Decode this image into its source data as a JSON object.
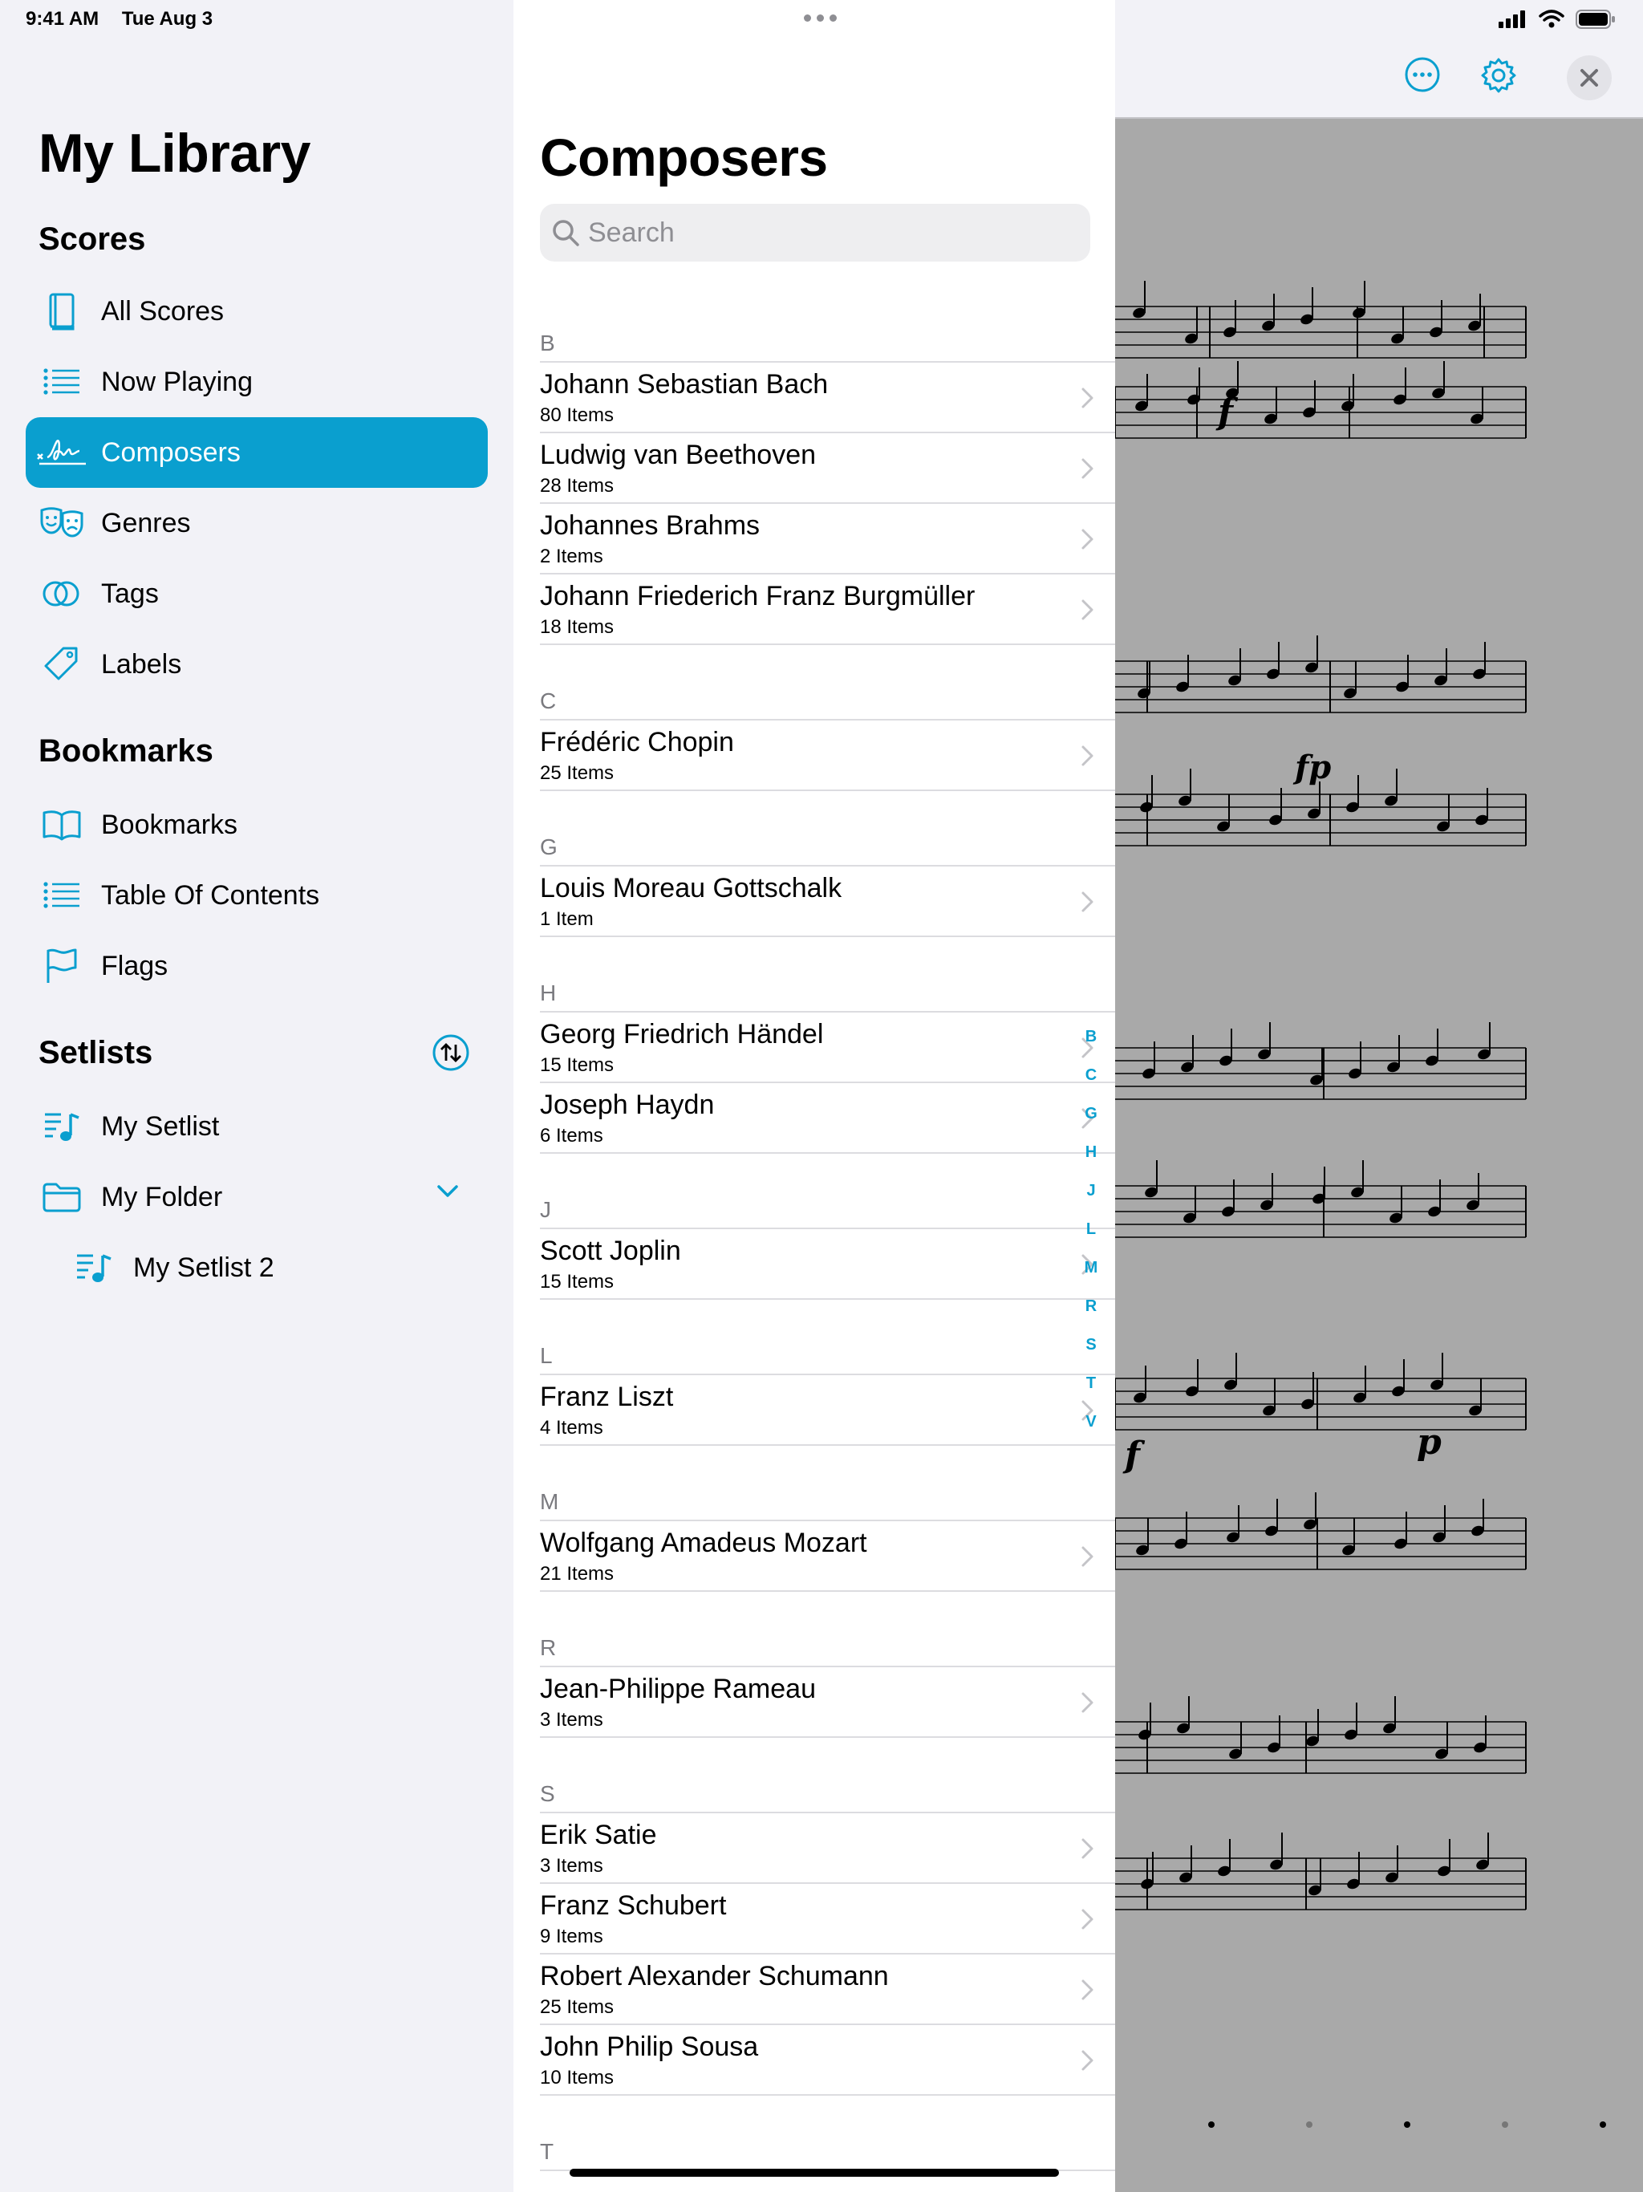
{
  "status_bar": {
    "time": "9:41 AM",
    "date": "Tue Aug 3"
  },
  "sidebar": {
    "title": "My Library",
    "sections": {
      "scores": "Scores",
      "bookmarks": "Bookmarks",
      "setlists": "Setlists"
    },
    "score_items": [
      {
        "label": "All Scores",
        "icon": "book-icon"
      },
      {
        "label": "Now Playing",
        "icon": "list-icon"
      },
      {
        "label": "Composers",
        "icon": "signature-icon",
        "selected": true
      },
      {
        "label": "Genres",
        "icon": "theater-masks-icon"
      },
      {
        "label": "Tags",
        "icon": "tags-icon"
      },
      {
        "label": "Labels",
        "icon": "label-tag-icon"
      }
    ],
    "bookmark_items": [
      {
        "label": "Bookmarks",
        "icon": "open-book-icon"
      },
      {
        "label": "Table Of Contents",
        "icon": "list-icon"
      },
      {
        "label": "Flags",
        "icon": "flag-icon"
      }
    ],
    "setlist_items": [
      {
        "label": "My Setlist",
        "icon": "setlist-icon"
      },
      {
        "label": "My Folder",
        "icon": "folder-icon"
      },
      {
        "label": "My Setlist 2",
        "icon": "setlist-icon"
      }
    ]
  },
  "list": {
    "title": "Composers",
    "search_placeholder": "Search",
    "sections": [
      {
        "letter": "B",
        "rows": [
          {
            "name": "Johann Sebastian Bach",
            "count": "80 Items"
          },
          {
            "name": "Ludwig van Beethoven",
            "count": "28 Items"
          },
          {
            "name": "Johannes Brahms",
            "count": "2 Items"
          },
          {
            "name": "Johann Friederich Franz Burgmüller",
            "count": "18 Items"
          }
        ]
      },
      {
        "letter": "C",
        "rows": [
          {
            "name": "Frédéric Chopin",
            "count": "25 Items"
          }
        ]
      },
      {
        "letter": "G",
        "rows": [
          {
            "name": "Louis Moreau Gottschalk",
            "count": "1 Item"
          }
        ]
      },
      {
        "letter": "H",
        "rows": [
          {
            "name": "Georg Friedrich Händel",
            "count": "15 Items"
          },
          {
            "name": "Joseph Haydn",
            "count": "6 Items"
          }
        ]
      },
      {
        "letter": "J",
        "rows": [
          {
            "name": "Scott Joplin",
            "count": "15 Items"
          }
        ]
      },
      {
        "letter": "L",
        "rows": [
          {
            "name": "Franz Liszt",
            "count": "4 Items"
          }
        ]
      },
      {
        "letter": "M",
        "rows": [
          {
            "name": "Wolfgang Amadeus Mozart",
            "count": "21 Items"
          }
        ]
      },
      {
        "letter": "R",
        "rows": [
          {
            "name": "Jean-Philippe Rameau",
            "count": "3 Items"
          }
        ]
      },
      {
        "letter": "S",
        "rows": [
          {
            "name": "Erik Satie",
            "count": "3 Items"
          },
          {
            "name": "Franz Schubert",
            "count": "9 Items"
          },
          {
            "name": "Robert Alexander Schumann",
            "count": "25 Items"
          },
          {
            "name": "John Philip Sousa",
            "count": "10 Items"
          }
        ]
      },
      {
        "letter": "T",
        "rows": []
      }
    ],
    "index_letters": [
      "B",
      "C",
      "G",
      "H",
      "J",
      "L",
      "M",
      "R",
      "S",
      "T",
      "V"
    ]
  },
  "score_view": {
    "dynamics": [
      "f",
      "fp",
      "f",
      "p"
    ]
  },
  "colors": {
    "accent": "#0a9fcf",
    "background": "#f2f2f7",
    "score_bg": "#a9a9a9"
  }
}
